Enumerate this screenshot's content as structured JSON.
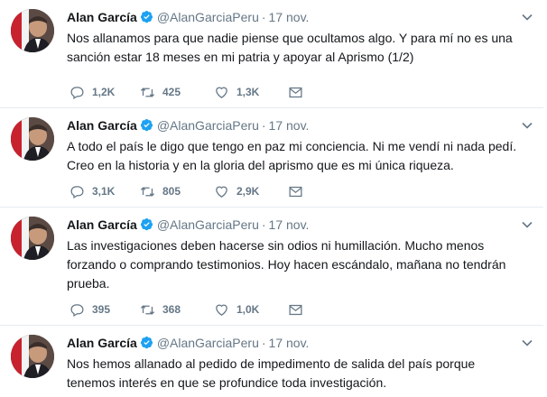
{
  "author": {
    "name": "Alan García",
    "handle": "@AlanGarciaPeru",
    "separator": "·",
    "verified": true
  },
  "icons": {
    "reply": "reply-icon",
    "retweet": "retweet-icon",
    "like": "heart-icon",
    "dm": "envelope-icon",
    "caret": "chevron-down-icon",
    "verified": "verified-badge-icon"
  },
  "colors": {
    "accent": "#1da1f2",
    "muted": "#657786",
    "border": "#e6ecf0"
  },
  "tweets": [
    {
      "time": "17 nov.",
      "text": "Nos allanamos para que nadie piense que ocultamos algo. Y para mí no es una sanción estar 18 meses en mi patria y apoyar al Aprismo (1/2)",
      "replies": "1,2K",
      "retweets": "425",
      "likes": "1,3K"
    },
    {
      "time": "17 nov.",
      "text": "A todo el país le digo que tengo en paz mi conciencia. Ni me vendí ni nada pedí. Creo en la historia y en la gloria del aprismo que es mi única riqueza.",
      "replies": "3,1K",
      "retweets": "805",
      "likes": "2,9K"
    },
    {
      "time": "17 nov.",
      "text": "Las investigaciones deben hacerse sin odios ni humillación. Mucho menos forzando o comprando testimonios. Hoy hacen escándalo, mañana no tendrán prueba.",
      "replies": "395",
      "retweets": "368",
      "likes": "1,0K"
    },
    {
      "time": "17 nov.",
      "text": "Nos hemos allanado al pedido de impedimento de salida del país  porque tenemos interés en que se profundice toda investigación.",
      "replies": "",
      "retweets": "",
      "likes": ""
    }
  ]
}
